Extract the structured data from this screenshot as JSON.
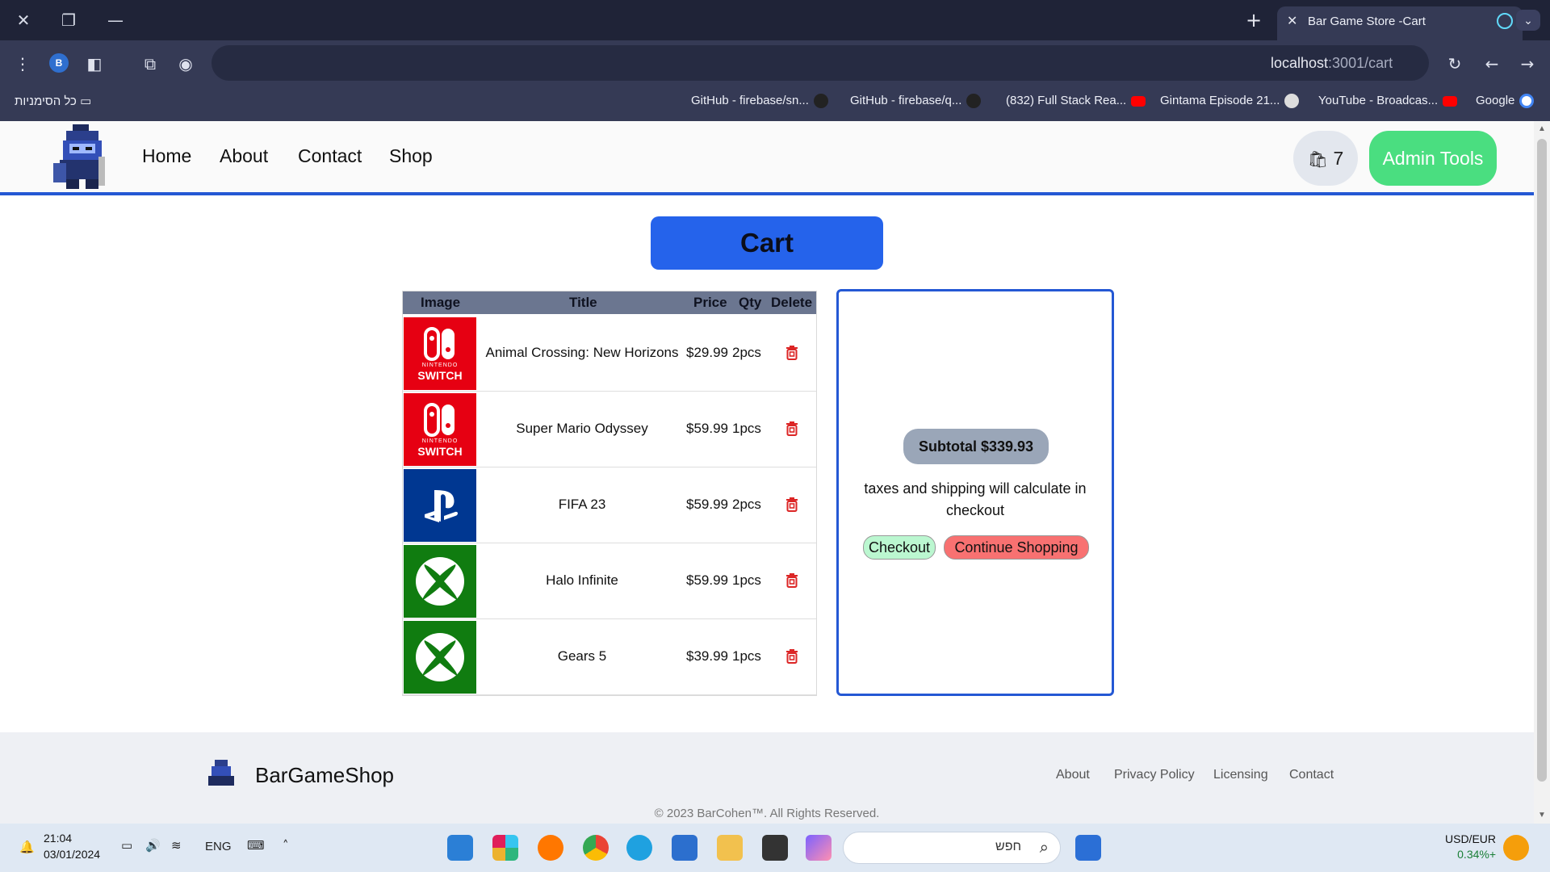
{
  "browser": {
    "tab_title": "Bar Game Store -Cart",
    "url_host": "localhost",
    "url_rest": ":3001/cart",
    "profile_initial": "B",
    "bookmarks": [
      "GitHub - firebase/sn...",
      "GitHub - firebase/q...",
      "(832) Full Stack Rea...",
      "Gintama Episode 21...",
      "YouTube - Broadcas...",
      "Google"
    ],
    "all_bookmarks_label": "כל הסימניות"
  },
  "nav": {
    "links": [
      "Home",
      "About",
      "Contact",
      "Shop"
    ],
    "cart_count": "7",
    "admin_label": "Admin Tools"
  },
  "cart": {
    "heading": "Cart",
    "columns": [
      "Image",
      "Title",
      "Price",
      "Qty",
      "Delete"
    ],
    "items": [
      {
        "title": "Animal Crossing: New Horizons",
        "price": "$29.99",
        "qty": "2pcs",
        "platform": "nintendo-switch",
        "color": "#e60012"
      },
      {
        "title": "Super Mario Odyssey",
        "price": "$59.99",
        "qty": "1pcs",
        "platform": "nintendo-switch",
        "color": "#e60012"
      },
      {
        "title": "FIFA 23",
        "price": "$59.99",
        "qty": "2pcs",
        "platform": "playstation",
        "color": "#003791"
      },
      {
        "title": "Halo Infinite",
        "price": "$59.99",
        "qty": "1pcs",
        "platform": "xbox",
        "color": "#107c10"
      },
      {
        "title": "Gears 5",
        "price": "$39.99",
        "qty": "1pcs",
        "platform": "xbox",
        "color": "#107c10"
      }
    ],
    "switch_text_top": "NINTENDO",
    "switch_text_bottom": "SWITCH"
  },
  "summary": {
    "subtotal": "Subtotal $339.93",
    "taxes_note": "taxes and shipping will calculate in checkout",
    "checkout_label": "Checkout",
    "continue_label": "Continue Shopping"
  },
  "footer": {
    "brand": "BarGameShop",
    "links": [
      "About",
      "Privacy Policy",
      "Licensing",
      "Contact"
    ],
    "copyright": "© 2023 BarCohen™. All Rights Reserved."
  },
  "taskbar": {
    "time": "21:04",
    "date": "03/01/2024",
    "lang": "ENG",
    "search_hint": "חפש",
    "fx_pair": "USD/EUR",
    "fx_change": "0.34%+"
  },
  "colors": {
    "accent_blue": "#2563eb",
    "admin_green": "#4ade80",
    "continue_red": "#f87171",
    "checkout_green": "#bbf7d0"
  }
}
